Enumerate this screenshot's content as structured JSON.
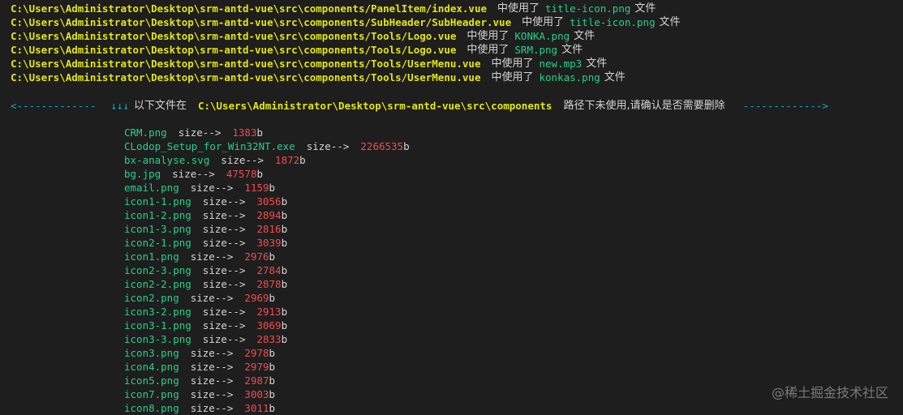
{
  "usage_lines": [
    {
      "path": "C:\\Users\\Administrator\\Desktop\\srm-antd-vue\\src\\components/PanelItem/index.vue",
      "mid": "中使用了",
      "file": "title-icon.png",
      "tail": "文件"
    },
    {
      "path": "C:\\Users\\Administrator\\Desktop\\srm-antd-vue\\src\\components/SubHeader/SubHeader.vue",
      "mid": "中使用了",
      "file": "title-icon.png",
      "tail": "文件"
    },
    {
      "path": "C:\\Users\\Administrator\\Desktop\\srm-antd-vue\\src\\components/Tools/Logo.vue",
      "mid": "中使用了",
      "file": "KONKA.png",
      "tail": "文件"
    },
    {
      "path": "C:\\Users\\Administrator\\Desktop\\srm-antd-vue\\src\\components/Tools/Logo.vue",
      "mid": "中使用了",
      "file": "SRM.png",
      "tail": "文件"
    },
    {
      "path": "C:\\Users\\Administrator\\Desktop\\srm-antd-vue\\src\\components/Tools/UserMenu.vue",
      "mid": "中使用了",
      "file": "new.mp3",
      "tail": "文件"
    },
    {
      "path": "C:\\Users\\Administrator\\Desktop\\srm-antd-vue\\src\\components/Tools/UserMenu.vue",
      "mid": "中使用了",
      "file": "konkas.png",
      "tail": "文件"
    }
  ],
  "banner": {
    "left_arrow": "<-------------",
    "arrows": "↓↓↓",
    "prefix": "以下文件在",
    "path": "C:\\Users\\Administrator\\Desktop\\srm-antd-vue\\src\\components",
    "suffix": "路径下未使用,请确认是否需要删除",
    "right_arrow": "------------->"
  },
  "size_label": "size-->",
  "unit": "b",
  "unused_files": [
    {
      "name": "CRM.png",
      "size": "1383"
    },
    {
      "name": "CLodop_Setup_for_Win32NT.exe",
      "size": "2266535"
    },
    {
      "name": "bx-analyse.svg",
      "size": "1872"
    },
    {
      "name": "bg.jpg",
      "size": "47578"
    },
    {
      "name": "email.png",
      "size": "1159"
    },
    {
      "name": "icon1-1.png",
      "size": "3056"
    },
    {
      "name": "icon1-2.png",
      "size": "2894"
    },
    {
      "name": "icon1-3.png",
      "size": "2816"
    },
    {
      "name": "icon2-1.png",
      "size": "3039"
    },
    {
      "name": "icon1.png",
      "size": "2976"
    },
    {
      "name": "icon2-3.png",
      "size": "2784"
    },
    {
      "name": "icon2-2.png",
      "size": "2878"
    },
    {
      "name": "icon2.png",
      "size": "2969"
    },
    {
      "name": "icon3-2.png",
      "size": "2913"
    },
    {
      "name": "icon3-1.png",
      "size": "3069"
    },
    {
      "name": "icon3-3.png",
      "size": "2833"
    },
    {
      "name": "icon3.png",
      "size": "2978"
    },
    {
      "name": "icon4.png",
      "size": "2979"
    },
    {
      "name": "icon5.png",
      "size": "2987"
    },
    {
      "name": "icon7.png",
      "size": "3003"
    },
    {
      "name": "icon8.png",
      "size": "3011"
    }
  ],
  "watermark": "@稀土掘金技术社区",
  "colors": {
    "background": "#1e1e1e",
    "path_yellow": "#e5e510",
    "file_green": "#23d18b",
    "arrow_cyan": "#11a8cd",
    "size_red": "#f14c4c",
    "text_white": "#d4d4d4"
  }
}
